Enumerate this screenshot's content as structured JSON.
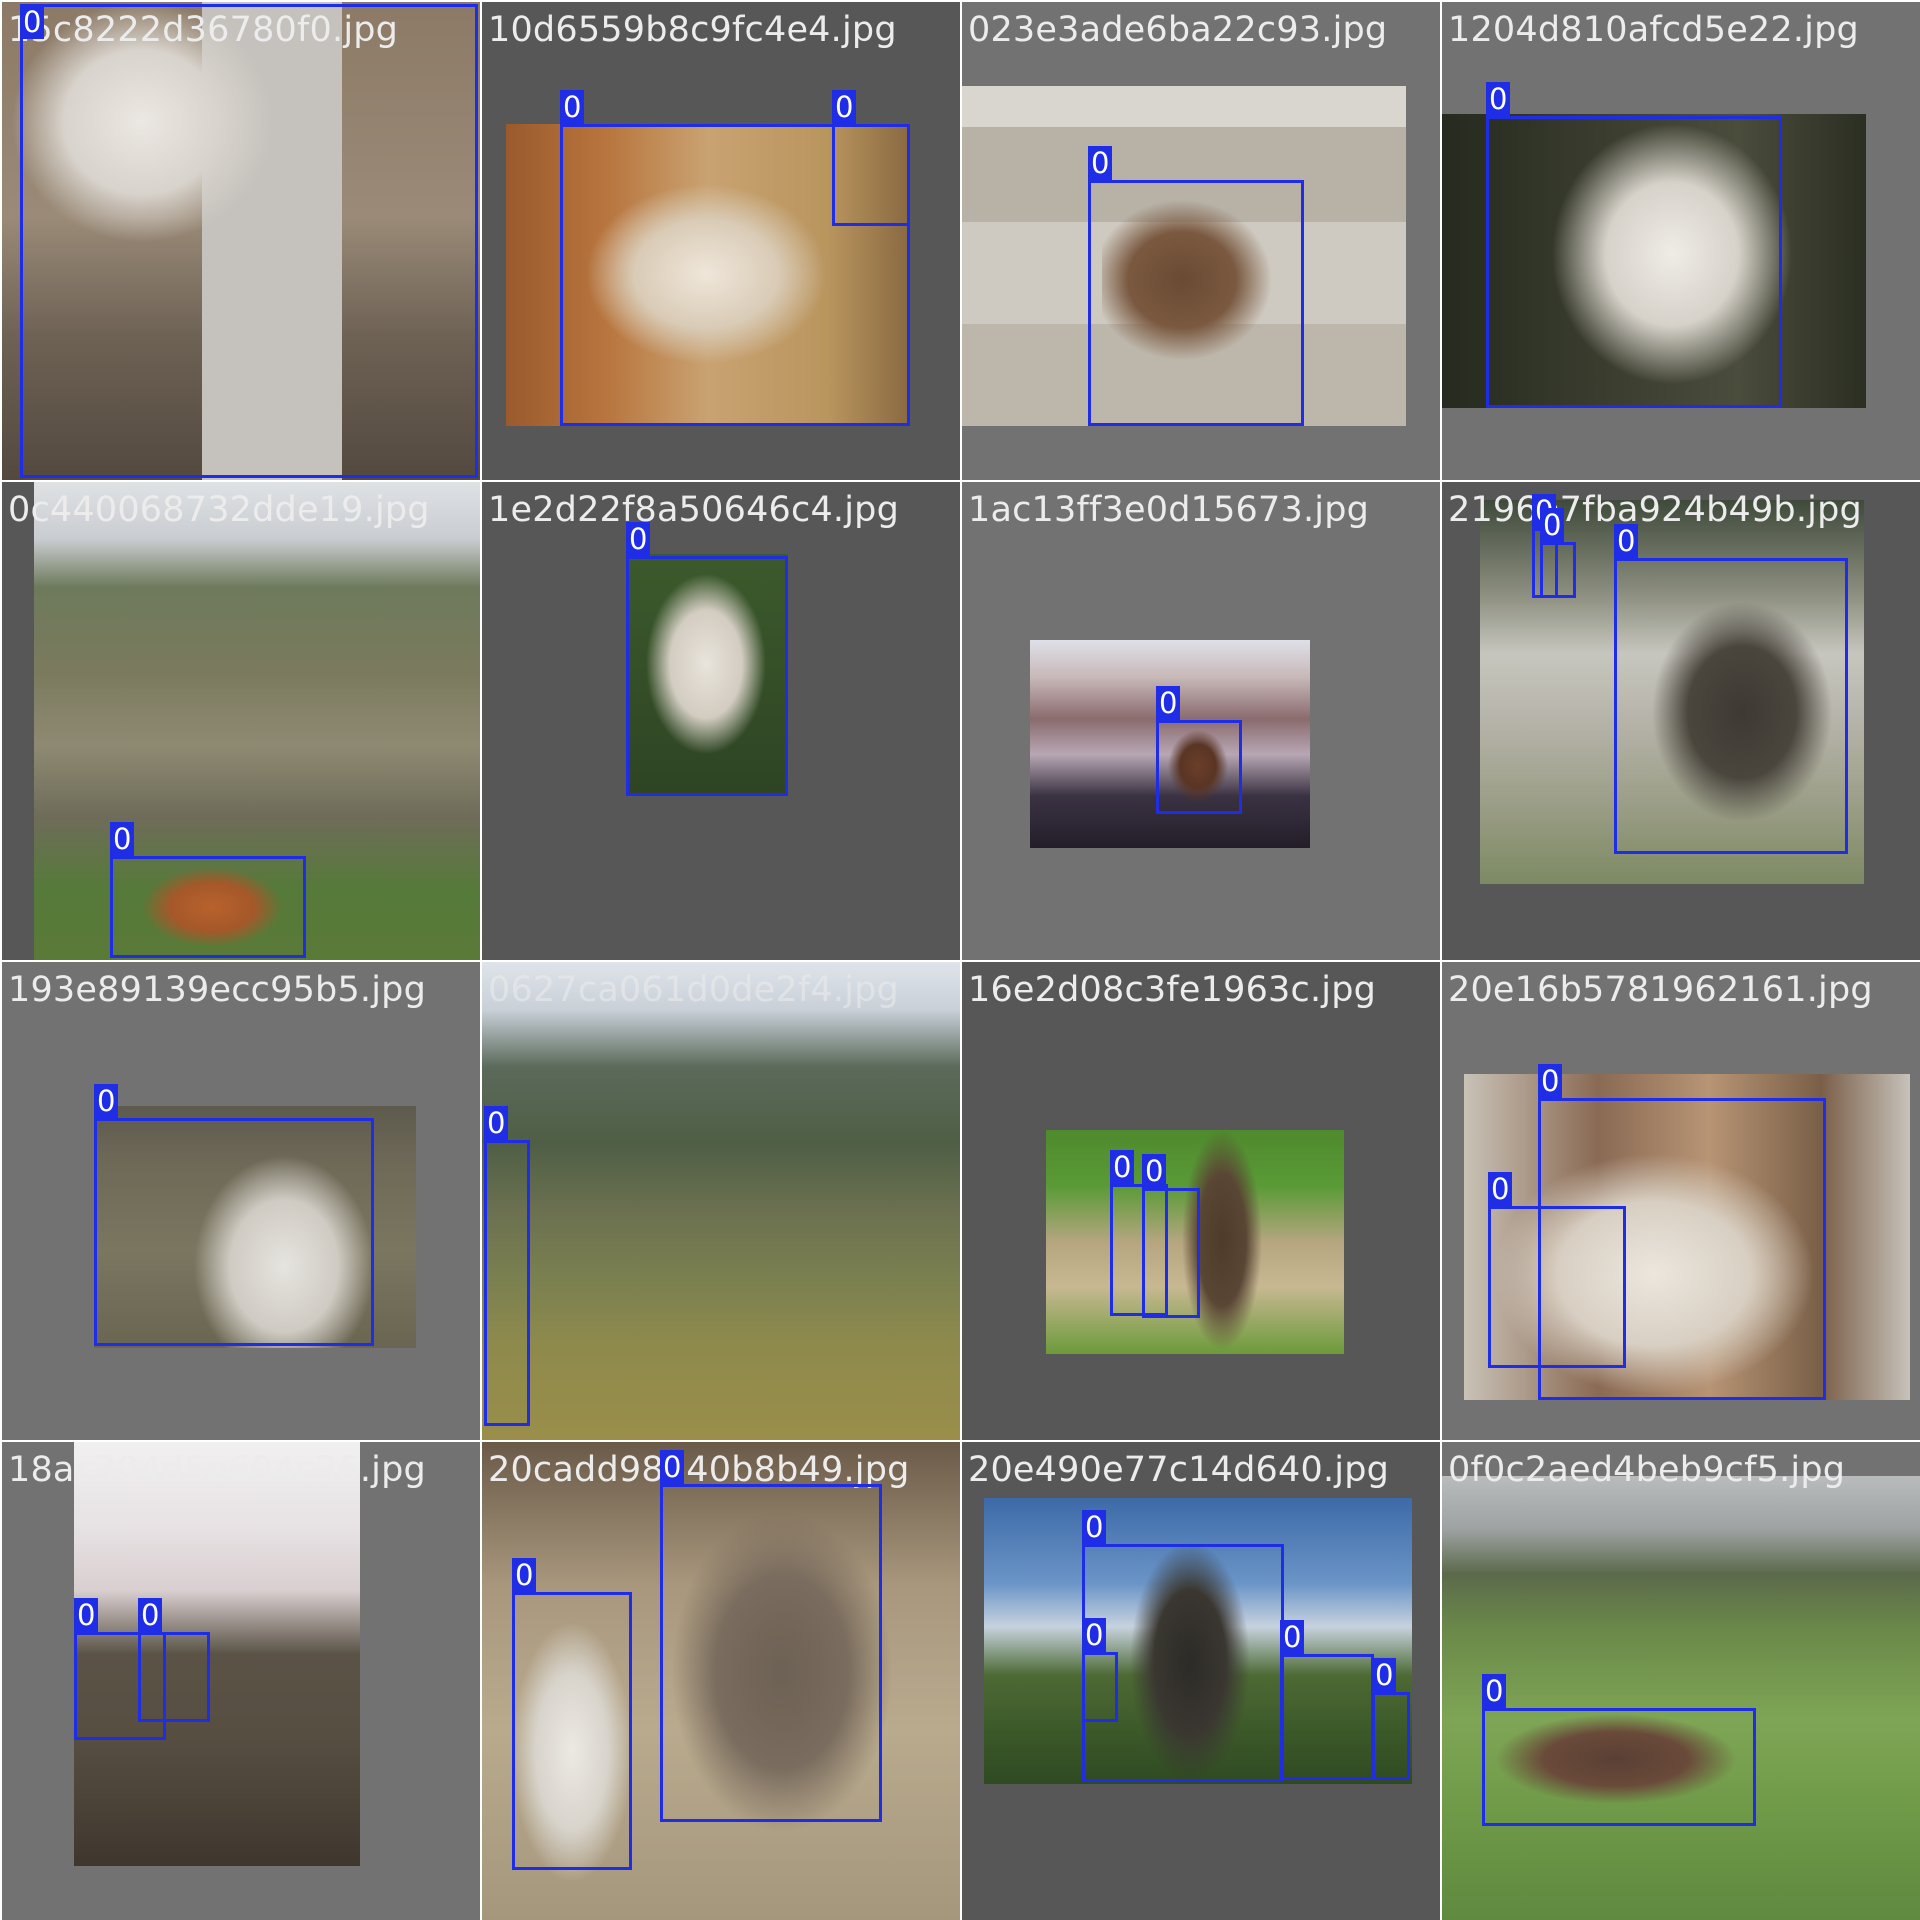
{
  "colors": {
    "box": "#1f2ee6",
    "tile_gray": "#727272",
    "tile_dark": "#575757",
    "caption": "#ececec"
  },
  "tiles": [
    {
      "filename": "15c8222d36780f0.jpg",
      "boxes": [
        {
          "label": "0"
        }
      ]
    },
    {
      "filename": "10d6559b8c9fc4e4.jpg",
      "boxes": [
        {
          "label": "0"
        },
        {
          "label": "0"
        }
      ]
    },
    {
      "filename": "023e3ade6ba22c93.jpg",
      "boxes": [
        {
          "label": "0"
        }
      ]
    },
    {
      "filename": "1204d810afcd5e22.jpg",
      "boxes": [
        {
          "label": "0"
        }
      ]
    },
    {
      "filename": "0c440068732dde19.jpg",
      "boxes": [
        {
          "label": "0"
        }
      ]
    },
    {
      "filename": "1e2d22f8a50646c4.jpg",
      "boxes": [
        {
          "label": "0"
        }
      ]
    },
    {
      "filename": "1ac13ff3e0d15673.jpg",
      "boxes": [
        {
          "label": "0"
        }
      ]
    },
    {
      "filename": "2196e7fba924b49b.jpg",
      "boxes": [
        {
          "label": "0"
        },
        {
          "label": "0"
        },
        {
          "label": "0"
        }
      ]
    },
    {
      "filename": "193e89139ecc95b5.jpg",
      "boxes": [
        {
          "label": "0"
        }
      ]
    },
    {
      "filename": "0627ca061d0de2f4.jpg",
      "boxes": [
        {
          "label": "0"
        }
      ]
    },
    {
      "filename": "16e2d08c3fe1963c.jpg",
      "boxes": [
        {
          "label": "0"
        },
        {
          "label": "0"
        }
      ]
    },
    {
      "filename": "20e16b5781962161.jpg",
      "boxes": [
        {
          "label": "0"
        },
        {
          "label": "0"
        }
      ]
    },
    {
      "filename": "18ac304d5e604c36.jpg",
      "boxes": [
        {
          "label": "0"
        },
        {
          "label": "0"
        }
      ]
    },
    {
      "filename": "20cadd98440b8b49.jpg",
      "boxes": [
        {
          "label": "0"
        },
        {
          "label": "0"
        }
      ]
    },
    {
      "filename": "20e490e77c14d640.jpg",
      "boxes": [
        {
          "label": "0"
        },
        {
          "label": "0"
        },
        {
          "label": "0"
        },
        {
          "label": "0"
        }
      ]
    },
    {
      "filename": "0f0c2aed4beb9cf5.jpg",
      "boxes": [
        {
          "label": "0"
        }
      ]
    }
  ]
}
